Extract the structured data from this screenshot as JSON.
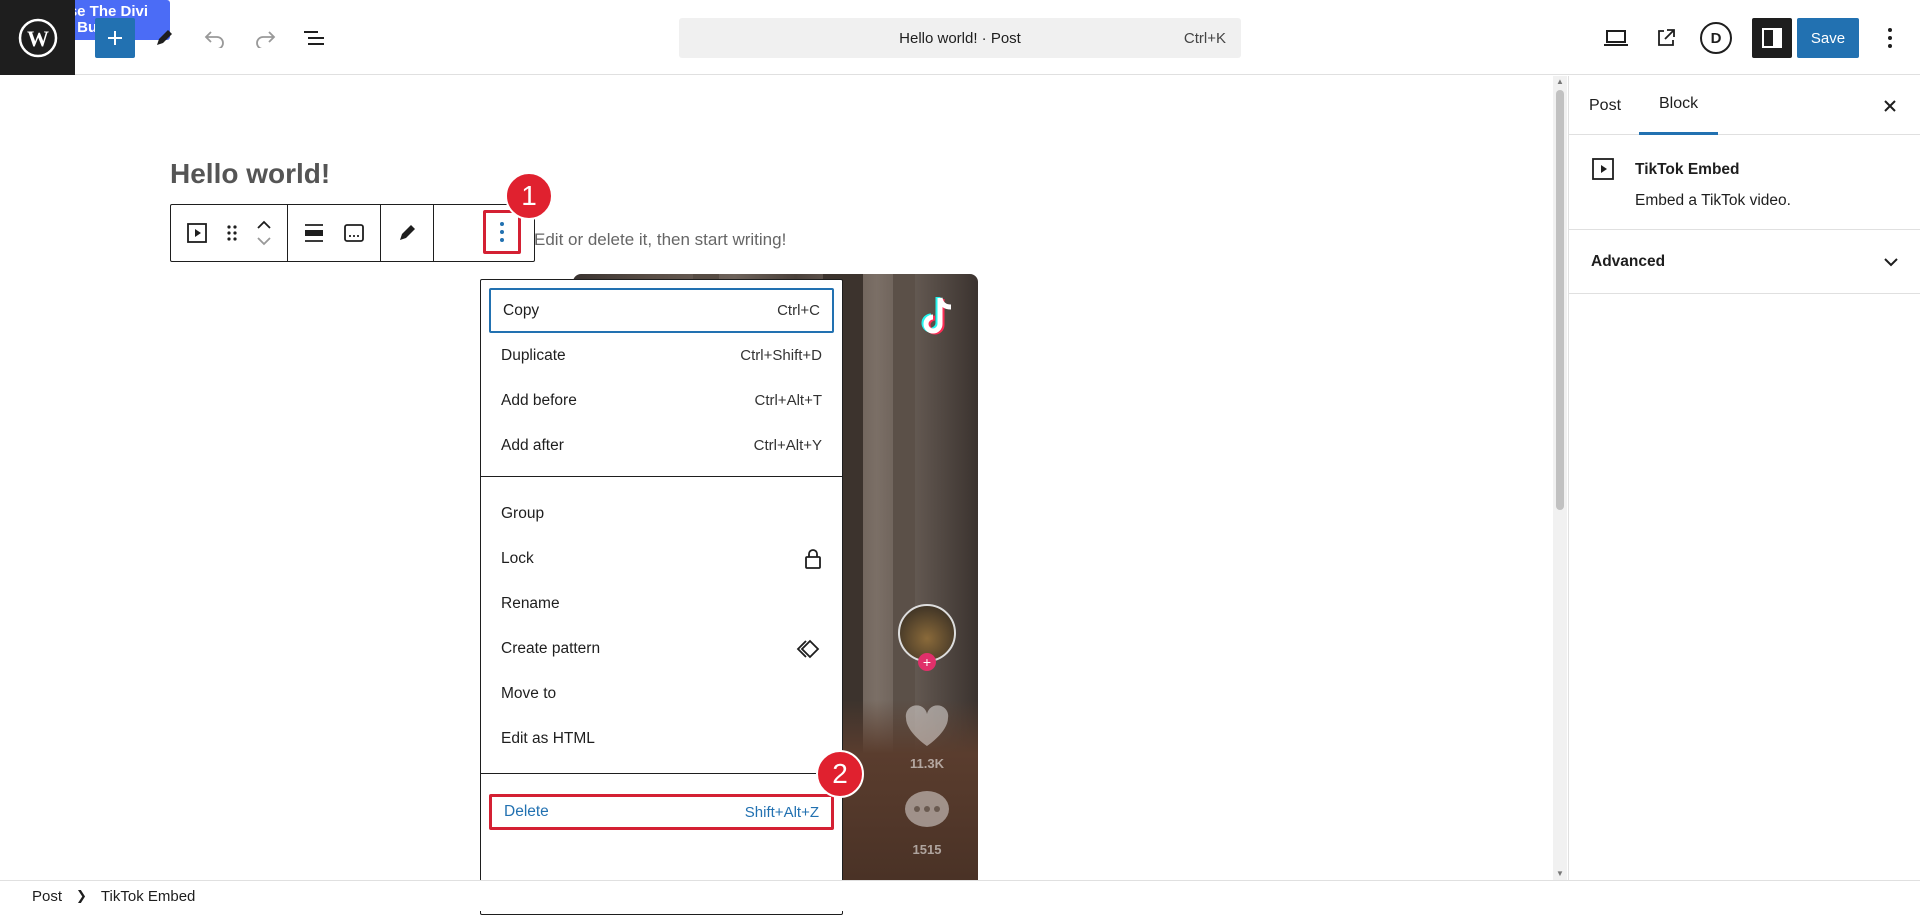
{
  "header": {
    "divi_label": "Use The Divi Builder",
    "divi_circle": "D",
    "command_title": "Hello world! · Post",
    "command_shortcut": "Ctrl+K",
    "divi_icon_letter": "D",
    "save_label": "Save"
  },
  "editor": {
    "post_title": "Hello world!",
    "paragraph_text": "Edit or delete it, then start writing!"
  },
  "badges": {
    "one": "1",
    "two": "2"
  },
  "tiktok": {
    "likes": "11.3K",
    "comments": "1515"
  },
  "menu": {
    "groups": [
      [
        {
          "label": "Copy",
          "shortcut": "Ctrl+C"
        },
        {
          "label": "Duplicate",
          "shortcut": "Ctrl+Shift+D"
        },
        {
          "label": "Add before",
          "shortcut": "Ctrl+Alt+T"
        },
        {
          "label": "Add after",
          "shortcut": "Ctrl+Alt+Y"
        }
      ],
      [
        {
          "label": "Group"
        },
        {
          "label": "Lock",
          "icon": "lock-icon"
        },
        {
          "label": "Rename"
        },
        {
          "label": "Create pattern",
          "icon": "pattern-icon"
        },
        {
          "label": "Move to"
        },
        {
          "label": "Edit as HTML"
        }
      ],
      [
        {
          "label": "Delete",
          "shortcut": "Shift+Alt+Z"
        }
      ]
    ]
  },
  "sidebar": {
    "tab_post": "Post",
    "tab_block": "Block",
    "block_title": "TikTok Embed",
    "block_desc": "Embed a TikTok video.",
    "advanced_label": "Advanced"
  },
  "footer": {
    "crumb_post": "Post",
    "crumb_block": "TikTok Embed"
  },
  "colors": {
    "accent": "#2271b1",
    "highlight": "#d42033",
    "divi": "#4b6cf6"
  }
}
